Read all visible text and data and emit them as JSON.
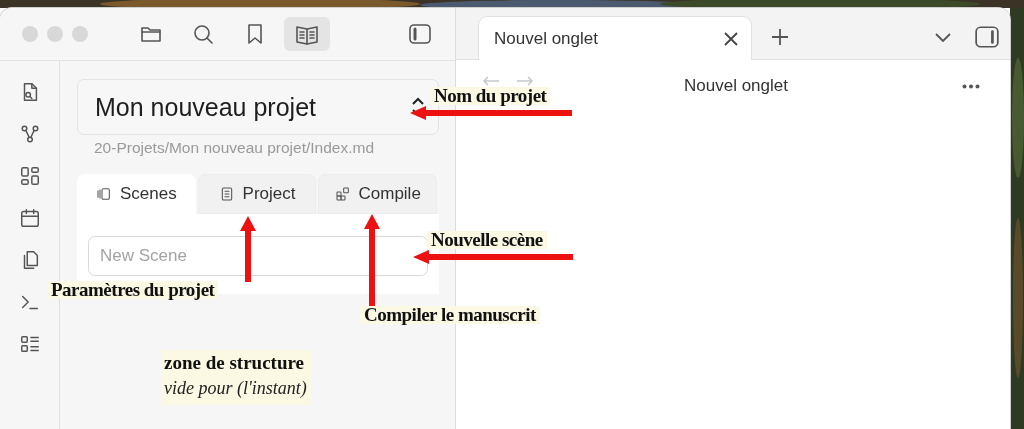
{
  "toolbar": [
    {
      "kind": "folder",
      "selected": false
    },
    {
      "kind": "search",
      "selected": false
    },
    {
      "kind": "bookmark",
      "selected": false
    },
    {
      "kind": "book",
      "selected": true
    }
  ],
  "ribbon": [
    {
      "kind": "file-search"
    },
    {
      "kind": "graph"
    },
    {
      "kind": "grid"
    },
    {
      "kind": "calendar"
    },
    {
      "kind": "copy"
    },
    {
      "kind": "terminal"
    },
    {
      "kind": "checklist"
    }
  ],
  "project": {
    "name": "Mon nouveau projet",
    "path": "20-Projets/Mon nouveau projet/Index.md"
  },
  "panel_tabs": [
    {
      "kind": "scenes",
      "label": "Scenes",
      "selected": true
    },
    {
      "kind": "project",
      "label": "Project",
      "selected": false
    },
    {
      "kind": "compile",
      "label": "Compile",
      "selected": false
    }
  ],
  "new_scene": {
    "placeholder": "New Scene"
  },
  "editor_tabs": [
    {
      "label": "Nouvel onglet",
      "selected": true
    }
  ],
  "editor": {
    "title": "Nouvel onglet",
    "back_disabled": true,
    "forward_disabled": true
  },
  "annotations": [
    {
      "kind": "left",
      "text": "Nom du projet"
    },
    {
      "kind": "left",
      "text": "Nouvelle scène"
    },
    {
      "kind": "up",
      "text": "Paramètres du projet"
    },
    {
      "kind": "up",
      "text": "Compiler le manuscrit"
    },
    {
      "kind": "note",
      "title": "zone de structure",
      "subtitle": "vide pour (l'instant)"
    }
  ]
}
